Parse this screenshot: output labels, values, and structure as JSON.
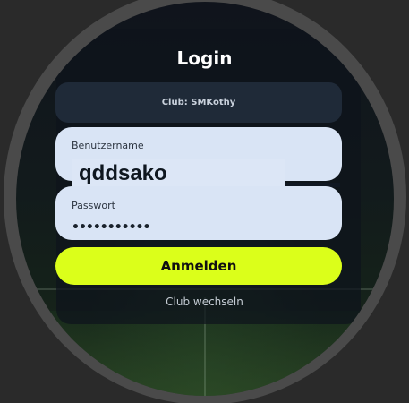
{
  "screen": {
    "title": "Login",
    "club_label": "Club: SMKothy",
    "username": {
      "label": "Benutzername",
      "value": "qddsako"
    },
    "password": {
      "label": "Passwort",
      "masked_value": "•••••••••••"
    },
    "login_button": "Anmelden",
    "switch_club_link": "Club wechseln"
  },
  "colors": {
    "accent_button": "#dbff1a",
    "field_background": "#d9e4f5",
    "club_box": "#1f2a38"
  }
}
